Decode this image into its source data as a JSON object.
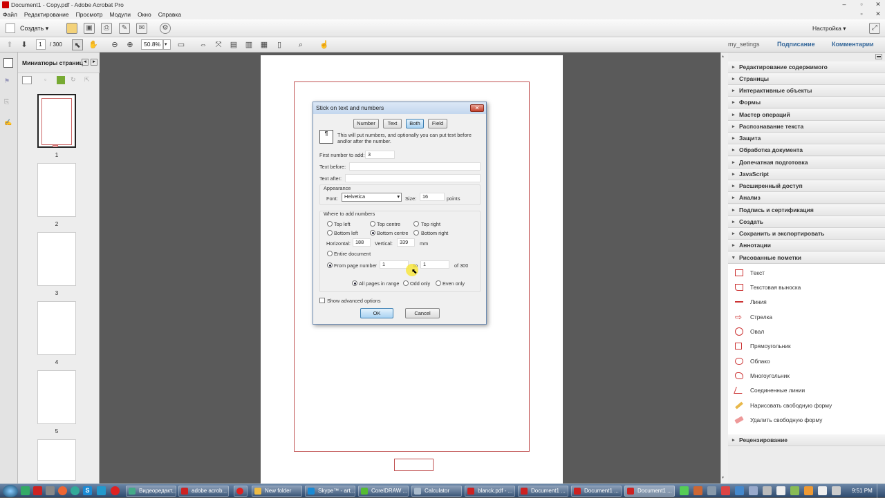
{
  "window": {
    "title": "Document1 - Copy.pdf - Adobe Acrobat Pro"
  },
  "menu": [
    "Файл",
    "Редактирование",
    "Просмотр",
    "Модули",
    "Окно",
    "Справка"
  ],
  "toolbar": {
    "create_label": "Создать",
    "customize_label": "Настройка"
  },
  "nav": {
    "page_current": "1",
    "page_total": "/ 300",
    "zoom": "50.8%",
    "my_settings": "my_setings",
    "sign": "Подписание",
    "comments": "Комментарии"
  },
  "thumbnails": {
    "title": "Миниатюры страниц",
    "pages": [
      "1",
      "2",
      "3",
      "4",
      "5"
    ]
  },
  "dialog": {
    "title": "Stick on text and numbers",
    "tabs": [
      "Number",
      "Text",
      "Both",
      "Field"
    ],
    "selected_tab": "Both",
    "description": "This will put numbers, and optionally you can put text before and/or after the number.",
    "first_number_label": "First number to add:",
    "first_number": "3",
    "text_before_label": "Text before:",
    "text_before": "",
    "text_after_label": "Text after:",
    "text_after": "",
    "appearance_label": "Appearance",
    "font_label": "Font:",
    "font_value": "Helvetica",
    "size_label": "Size:",
    "size_value": "16",
    "size_unit": "points",
    "where_label": "Where to add numbers",
    "positions": [
      "Top left",
      "Top centre",
      "Top right",
      "Bottom left",
      "Bottom centre",
      "Bottom right"
    ],
    "selected_position": "Bottom centre",
    "horizontal_label": "Horizontal:",
    "horizontal": "188",
    "vertical_label": "Vertical:",
    "vertical": "339",
    "unit": "mm",
    "entire_doc": "Entire document",
    "from_page": "From page number",
    "from_value": "1",
    "to_label": "to",
    "to_value": "1",
    "of_label": "of 300",
    "range_opts": [
      "All pages in range",
      "Odd only",
      "Even only"
    ],
    "show_advanced": "Show advanced options",
    "ok": "OK",
    "cancel": "Cancel"
  },
  "right_panel": {
    "sections_top": [
      "Редактирование содержимого",
      "Страницы",
      "Интерактивные объекты",
      "Формы",
      "Мастер операций",
      "Распознавание текста",
      "Защита",
      "Обработка документа",
      "Допечатная подготовка",
      "JavaScript",
      "Расширенный доступ",
      "Анализ",
      "Подпись и сертификация",
      "Создать",
      "Сохранить и экспортировать",
      "Аннотации",
      "Рисованные пометки"
    ],
    "tools": [
      "Текст",
      "Текстовая выноска",
      "Линия",
      "Стрелка",
      "Овал",
      "Прямоугольник",
      "Облако",
      "Многоугольник",
      "Соединенные линии",
      "Нарисовать свободную форму",
      "Удалить свободную форму"
    ],
    "section_bottom": "Рецензирование"
  },
  "taskbar": {
    "items": [
      "Видеоредакт...",
      "adobe acrob...",
      "New folder",
      "Skype™ - art...",
      "CorelDRAW ...",
      "Calculator",
      "blanck.pdf - ...",
      "Document1 ...",
      "Document1 ...",
      "Document1 ..."
    ],
    "clock": "9:51 PM"
  }
}
